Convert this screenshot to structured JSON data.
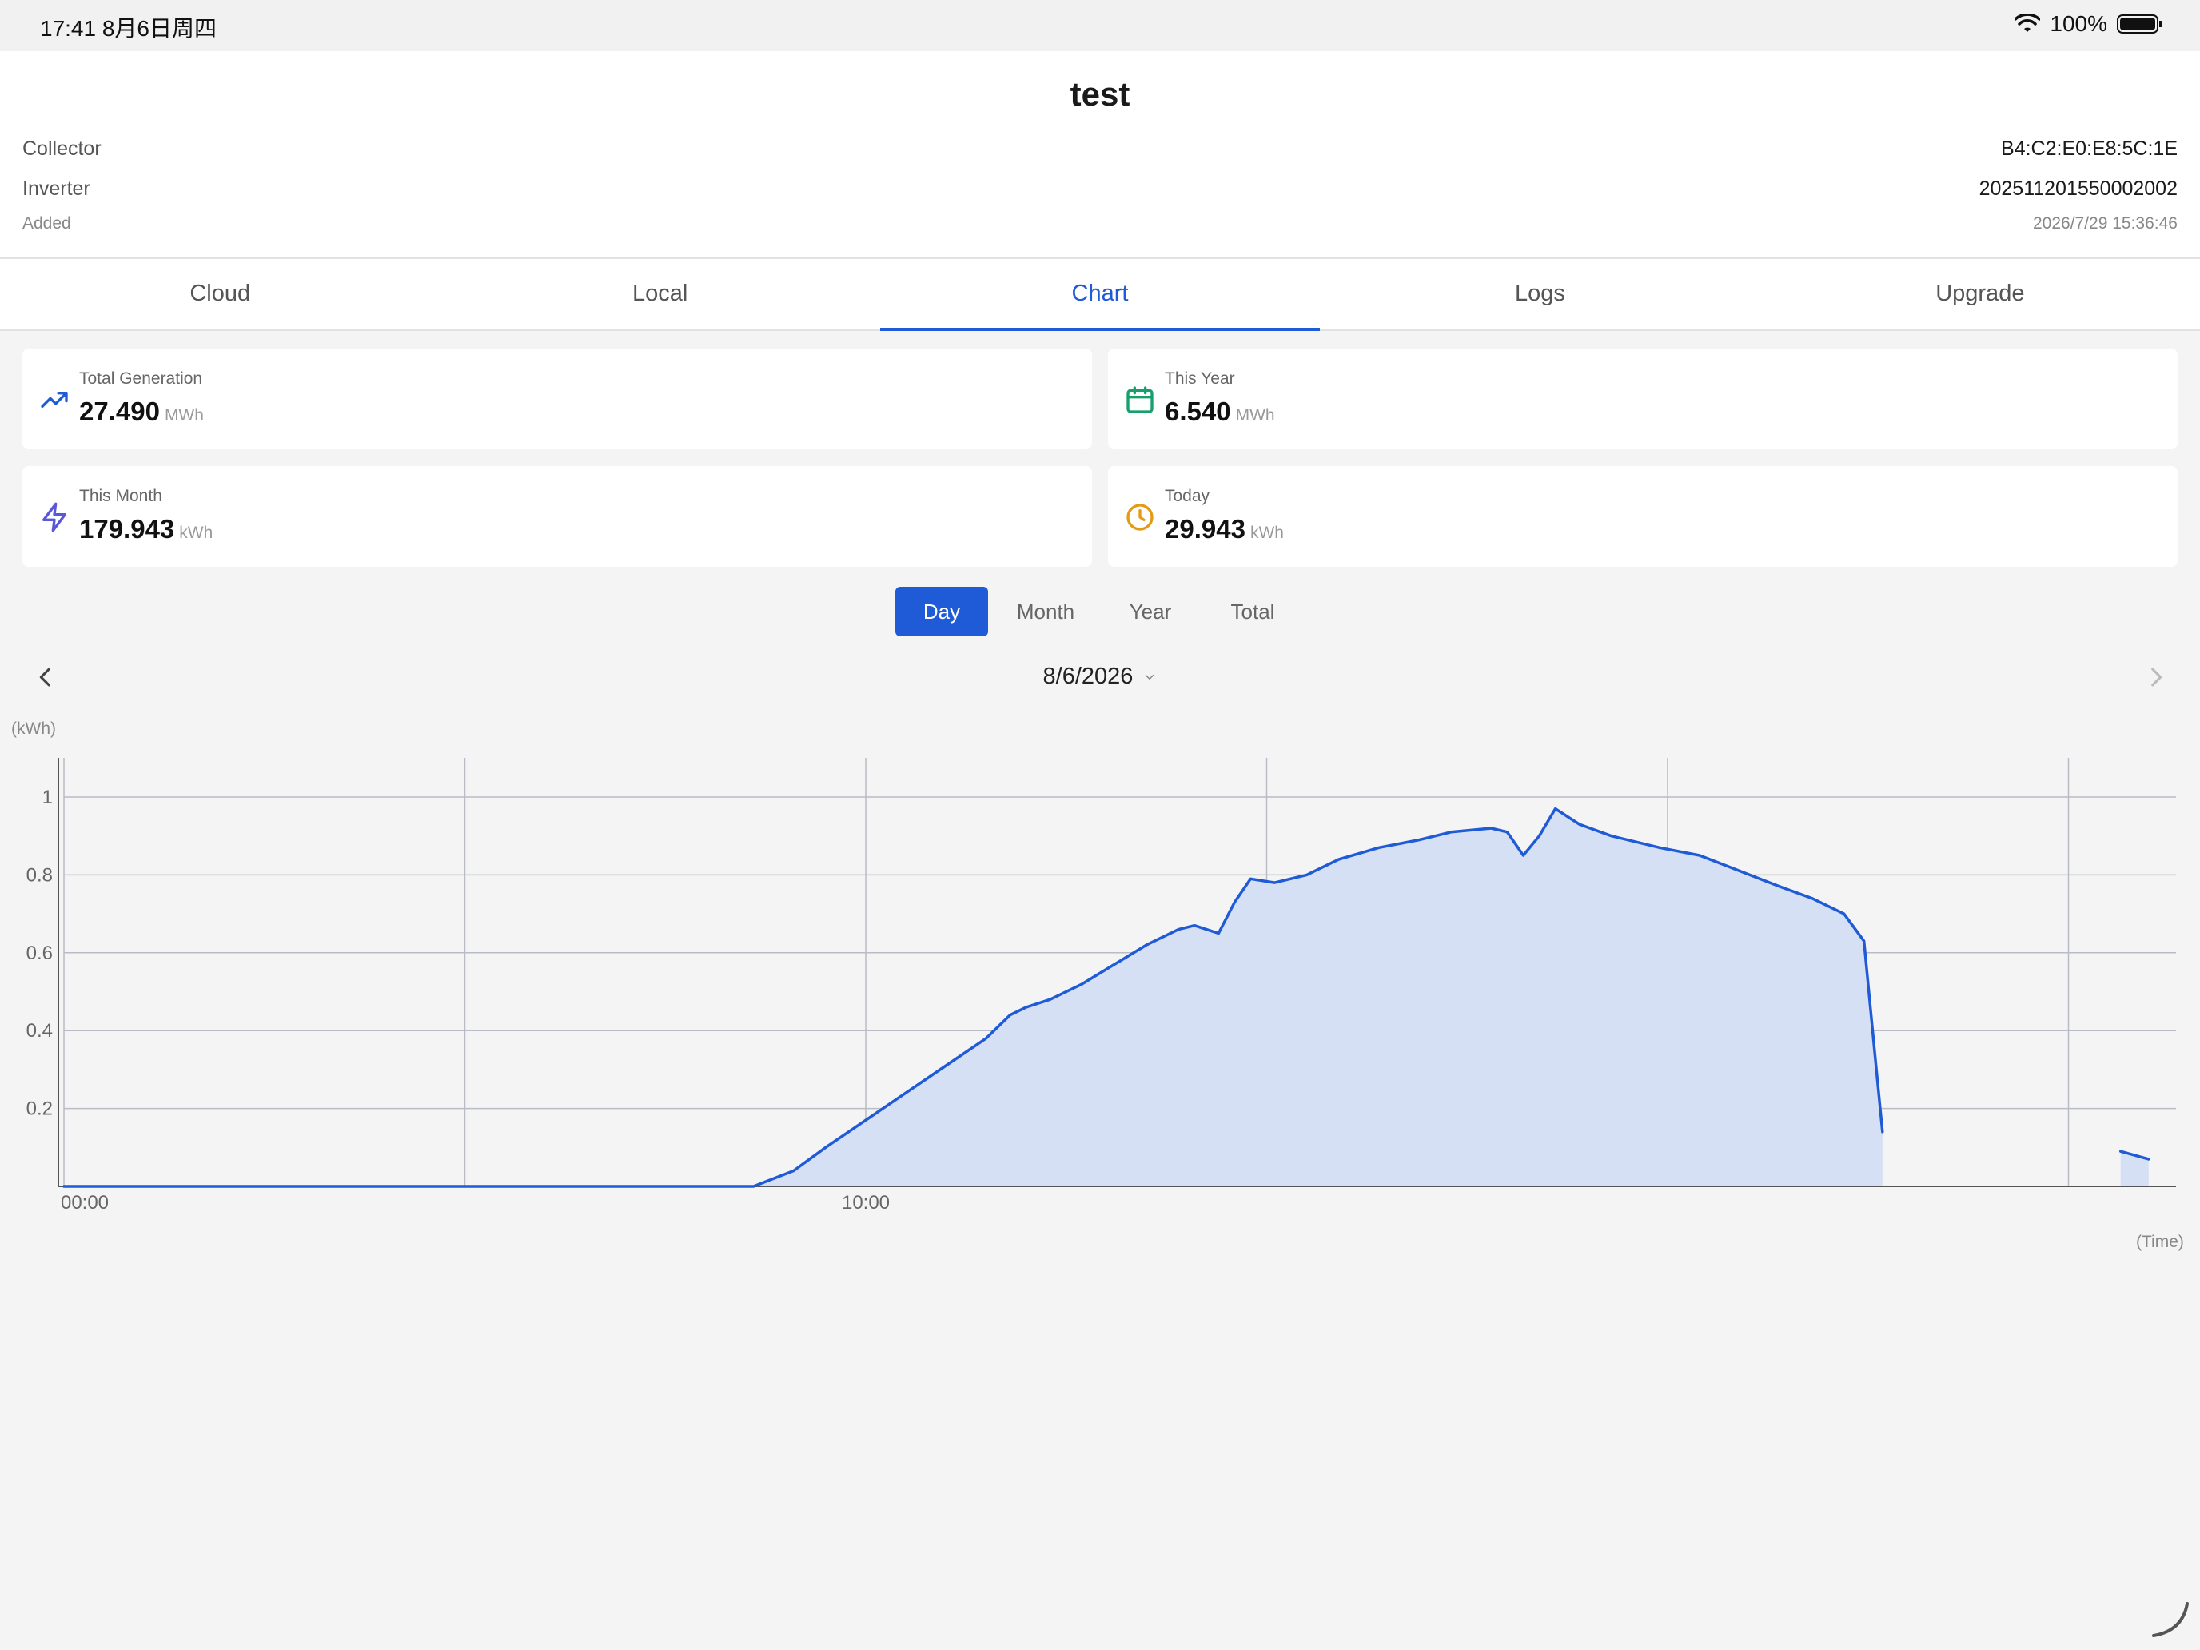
{
  "status_bar": {
    "time": "17:41  8月6日周四",
    "battery": "100%"
  },
  "device": {
    "name": "test",
    "collector_label": "Collector",
    "collector_value": "B4:C2:E0:E8:5C:1E",
    "inverter_label": "Inverter",
    "inverter_value": "202511201550002002",
    "added_label": "Added",
    "added_value": "2026/7/29 15:36:46"
  },
  "tabs": [
    "Cloud",
    "Local",
    "Chart",
    "Logs",
    "Upgrade"
  ],
  "active_tab": "Chart",
  "stats": [
    {
      "label": "Total Generation",
      "value": "27.490",
      "unit": "MWh",
      "icon": "trending-up-icon",
      "color": "#1f5bd6"
    },
    {
      "label": "This Year",
      "value": "6.540",
      "unit": "MWh",
      "icon": "calendar-icon",
      "color": "#16a06c"
    },
    {
      "label": "This Month",
      "value": "179.943",
      "unit": "kWh",
      "icon": "lightning-icon",
      "color": "#5b57d9"
    },
    {
      "label": "Today",
      "value": "29.943",
      "unit": "kWh",
      "icon": "clock-icon",
      "color": "#e69a12"
    }
  ],
  "period_tabs": [
    "Day",
    "Month",
    "Year",
    "Total"
  ],
  "active_period": "Day",
  "date": "8/6/2026",
  "chart_data": {
    "type": "area",
    "ylabel": "(kWh)",
    "xlabel": "(Time)",
    "x_tick_labels": [
      "00:00",
      "10:00"
    ],
    "y_ticks": [
      0.2,
      0.4,
      0.6,
      0.8,
      1
    ],
    "ylim": [
      0,
      1.1
    ],
    "xlim_hours": [
      0,
      26.2
    ],
    "grid": true,
    "line_color": "#1f5bd6",
    "fill_color": "#d5e0f4",
    "series": [
      {
        "segments": [
          [
            [
              0,
              0
            ],
            [
              8.6,
              0
            ],
            [
              9.1,
              0.04
            ],
            [
              9.5,
              0.1
            ],
            [
              10.0,
              0.17
            ],
            [
              10.5,
              0.24
            ],
            [
              11.0,
              0.31
            ],
            [
              11.5,
              0.38
            ],
            [
              11.8,
              0.44
            ],
            [
              12.0,
              0.46
            ],
            [
              12.3,
              0.48
            ],
            [
              12.7,
              0.52
            ],
            [
              13.1,
              0.57
            ],
            [
              13.5,
              0.62
            ],
            [
              13.9,
              0.66
            ],
            [
              14.1,
              0.67
            ],
            [
              14.4,
              0.65
            ],
            [
              14.6,
              0.73
            ],
            [
              14.8,
              0.79
            ],
            [
              15.1,
              0.78
            ],
            [
              15.5,
              0.8
            ],
            [
              15.9,
              0.84
            ],
            [
              16.4,
              0.87
            ],
            [
              16.9,
              0.89
            ],
            [
              17.3,
              0.91
            ],
            [
              17.8,
              0.92
            ],
            [
              18.0,
              0.91
            ],
            [
              18.2,
              0.85
            ],
            [
              18.4,
              0.9
            ],
            [
              18.6,
              0.97
            ],
            [
              18.9,
              0.93
            ],
            [
              19.3,
              0.9
            ],
            [
              19.9,
              0.87
            ],
            [
              20.4,
              0.85
            ],
            [
              20.9,
              0.81
            ],
            [
              21.4,
              0.77
            ],
            [
              21.8,
              0.74
            ],
            [
              22.2,
              0.7
            ],
            [
              22.45,
              0.63
            ],
            [
              22.58,
              0.35
            ],
            [
              22.68,
              0.14
            ]
          ],
          [
            [
              25.65,
              0.09
            ],
            [
              26.0,
              0.07
            ]
          ]
        ]
      }
    ]
  }
}
